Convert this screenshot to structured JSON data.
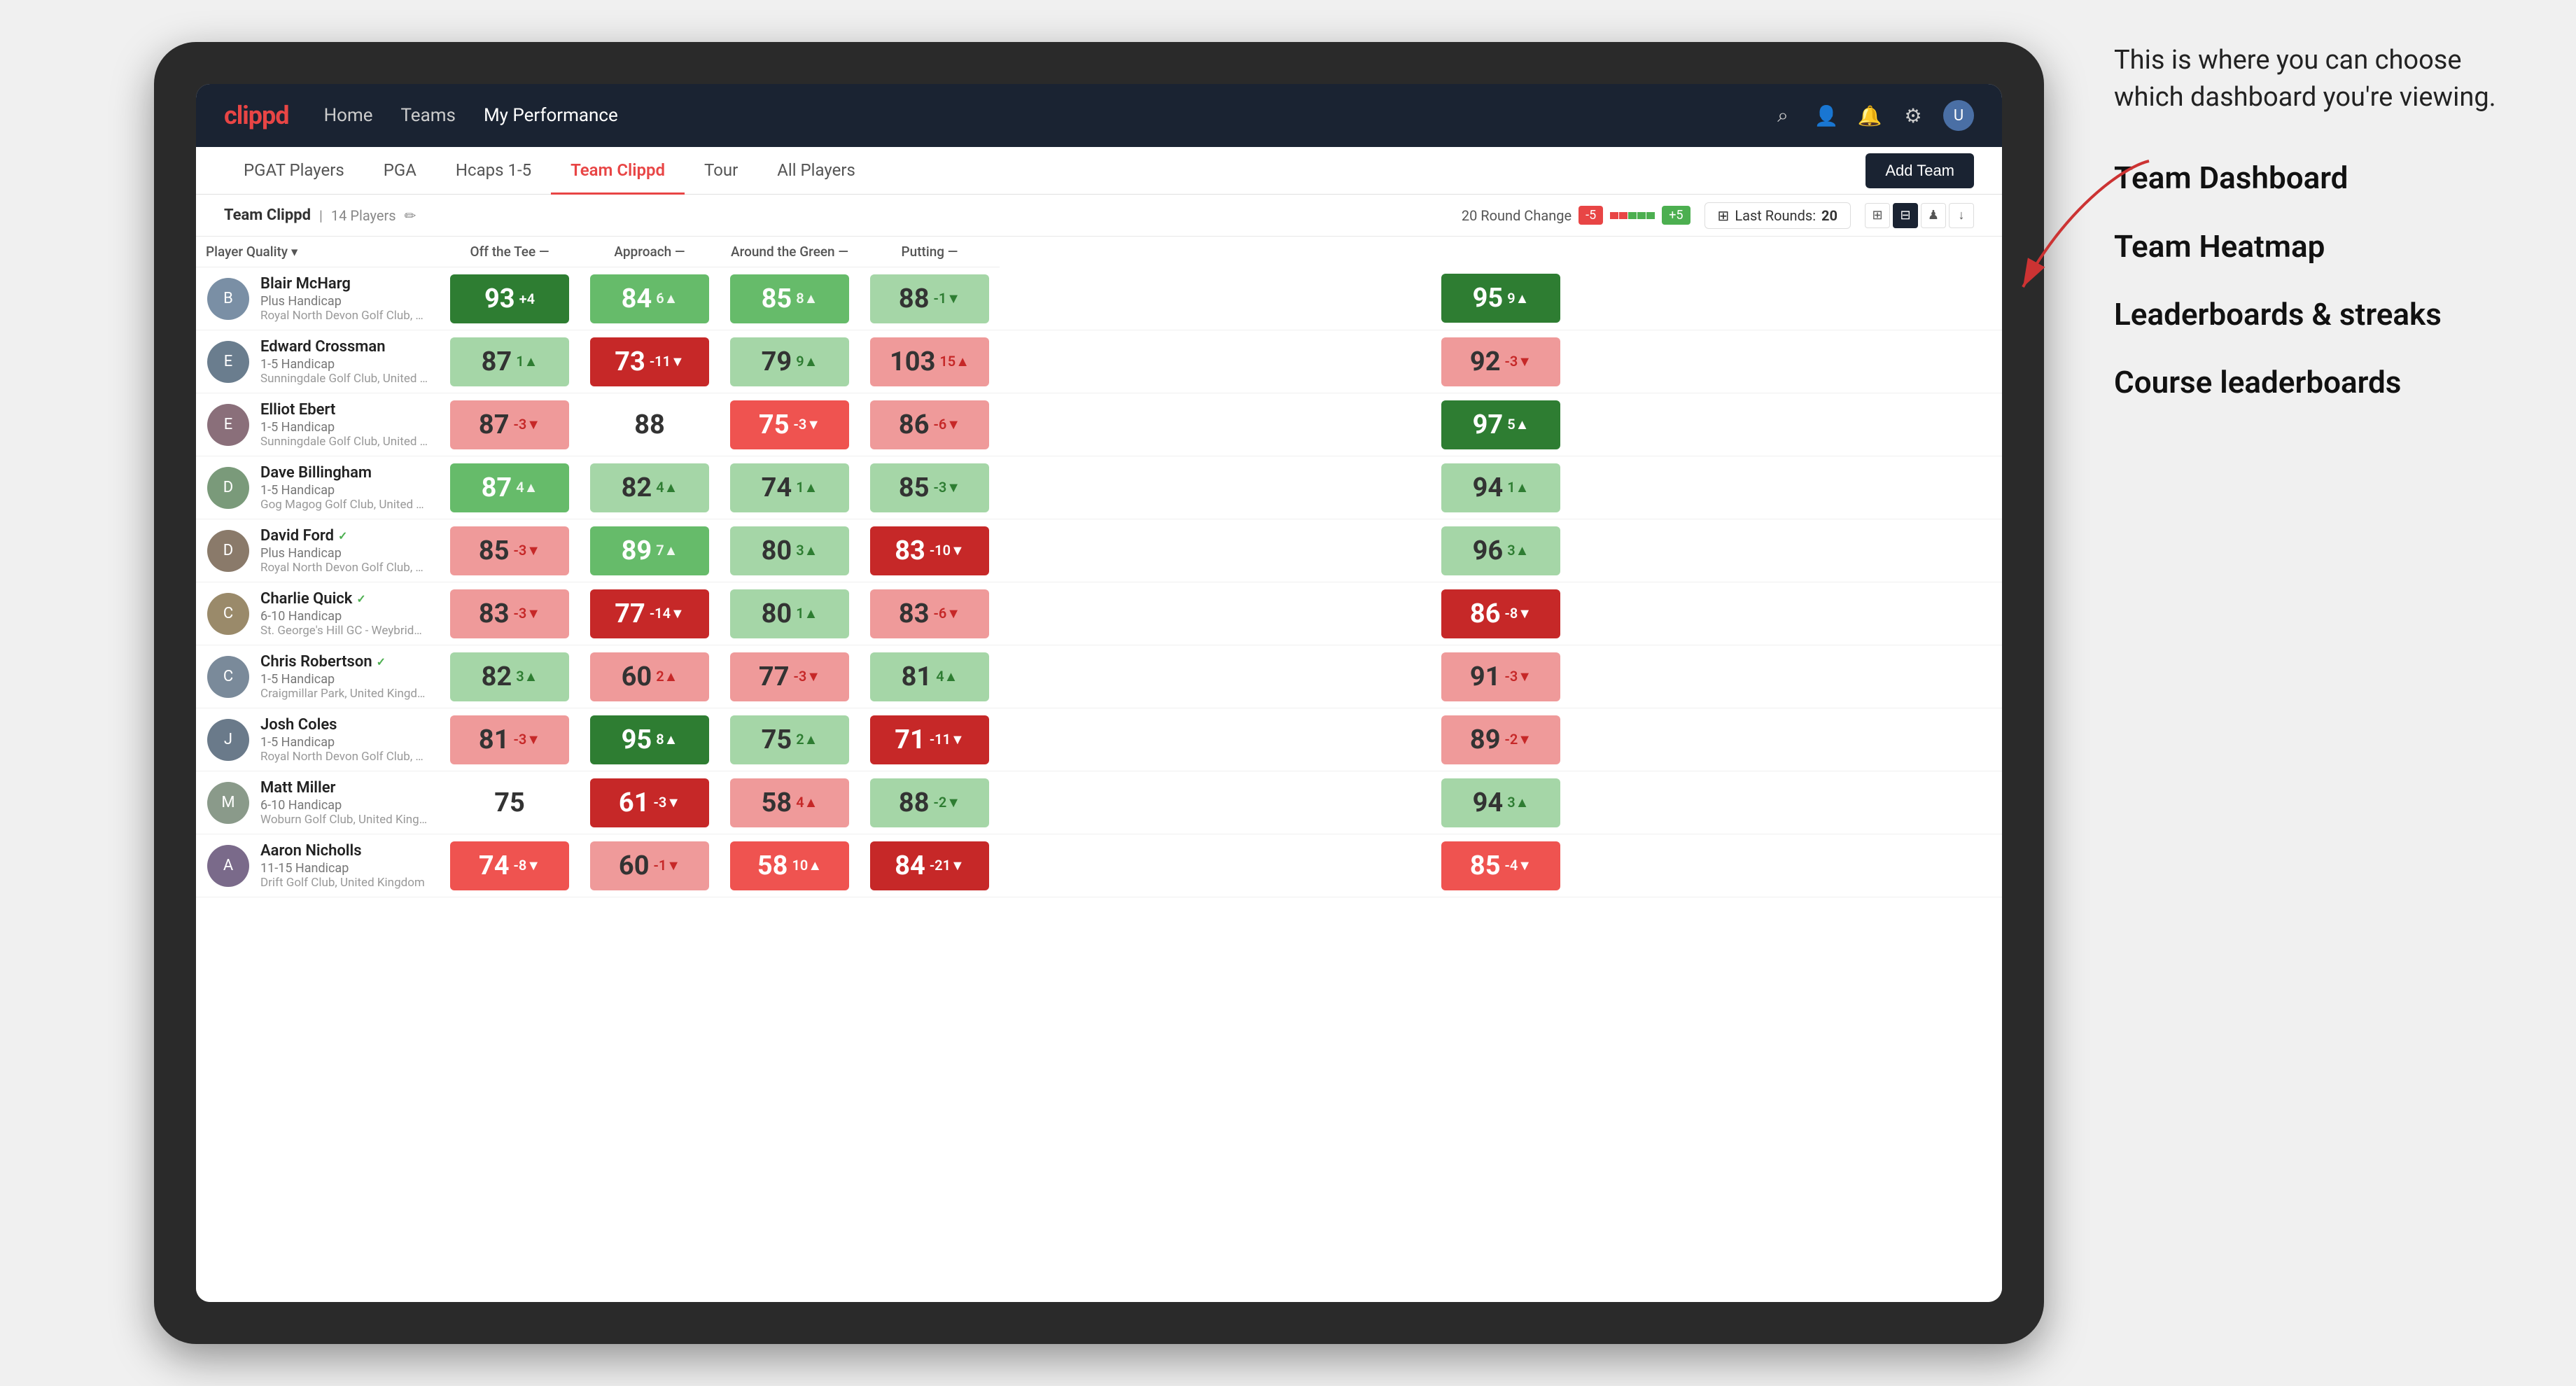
{
  "annotation": {
    "intro": "This is where you can choose which dashboard you're viewing.",
    "items": [
      "Team Dashboard",
      "Team Heatmap",
      "Leaderboards & streaks",
      "Course leaderboards"
    ]
  },
  "navbar": {
    "logo": "clippd",
    "nav_items": [
      "Home",
      "Teams",
      "My Performance"
    ],
    "active_nav": "My Performance"
  },
  "subnav": {
    "tabs": [
      "PGAT Players",
      "PGA",
      "Hcaps 1-5",
      "Team Clippd",
      "Tour",
      "All Players"
    ],
    "active_tab": "Team Clippd",
    "add_team_label": "Add Team"
  },
  "team_header": {
    "name": "Team Clippd",
    "separator": "|",
    "player_count": "14 Players",
    "round_change_label": "20 Round Change",
    "change_neg": "-5",
    "change_pos": "+5",
    "last_rounds_label": "Last Rounds:",
    "last_rounds_value": "20"
  },
  "columns": {
    "player": "Player Quality",
    "off_tee": "Off the Tee",
    "approach": "Approach",
    "around_green": "Around the Green",
    "putting": "Putting"
  },
  "players": [
    {
      "name": "Blair McHarg",
      "handicap": "Plus Handicap",
      "club": "Royal North Devon Golf Club, United Kingdom",
      "avatar_color": "#7a8fa5",
      "scores": {
        "quality": {
          "value": 93,
          "delta": "+4",
          "dir": "up",
          "heat": "heat-green-strong"
        },
        "off_tee": {
          "value": 84,
          "delta": "6▲",
          "dir": "up",
          "heat": "heat-green-med"
        },
        "approach": {
          "value": 85,
          "delta": "8▲",
          "dir": "up",
          "heat": "heat-green-med"
        },
        "around_green": {
          "value": 88,
          "delta": "-1▼",
          "dir": "down",
          "heat": "heat-green-light"
        },
        "putting": {
          "value": 95,
          "delta": "9▲",
          "dir": "up",
          "heat": "heat-green-strong"
        }
      }
    },
    {
      "name": "Edward Crossman",
      "handicap": "1-5 Handicap",
      "club": "Sunningdale Golf Club, United Kingdom",
      "avatar_color": "#6a7d8e",
      "scores": {
        "quality": {
          "value": 87,
          "delta": "1▲",
          "dir": "up",
          "heat": "heat-green-light"
        },
        "off_tee": {
          "value": 73,
          "delta": "-11▼",
          "dir": "down",
          "heat": "heat-red-strong"
        },
        "approach": {
          "value": 79,
          "delta": "9▲",
          "dir": "up",
          "heat": "heat-green-light"
        },
        "around_green": {
          "value": 103,
          "delta": "15▲",
          "dir": "up",
          "heat": "heat-red-light"
        },
        "putting": {
          "value": 92,
          "delta": "-3▼",
          "dir": "down",
          "heat": "heat-red-light"
        }
      }
    },
    {
      "name": "Elliot Ebert",
      "handicap": "1-5 Handicap",
      "club": "Sunningdale Golf Club, United Kingdom",
      "avatar_color": "#8a6f7a",
      "scores": {
        "quality": {
          "value": 87,
          "delta": "-3▼",
          "dir": "down",
          "heat": "heat-red-light"
        },
        "off_tee": {
          "value": 88,
          "delta": "",
          "dir": "neutral",
          "heat": "heat-neutral"
        },
        "approach": {
          "value": 75,
          "delta": "-3▼",
          "dir": "down",
          "heat": "heat-red-med"
        },
        "around_green": {
          "value": 86,
          "delta": "-6▼",
          "dir": "down",
          "heat": "heat-red-light"
        },
        "putting": {
          "value": 97,
          "delta": "5▲",
          "dir": "up",
          "heat": "heat-green-strong"
        }
      }
    },
    {
      "name": "Dave Billingham",
      "handicap": "1-5 Handicap",
      "club": "Gog Magog Golf Club, United Kingdom",
      "avatar_color": "#7a9a7a",
      "scores": {
        "quality": {
          "value": 87,
          "delta": "4▲",
          "dir": "up",
          "heat": "heat-green-med"
        },
        "off_tee": {
          "value": 82,
          "delta": "4▲",
          "dir": "up",
          "heat": "heat-green-light"
        },
        "approach": {
          "value": 74,
          "delta": "1▲",
          "dir": "up",
          "heat": "heat-green-light"
        },
        "around_green": {
          "value": 85,
          "delta": "-3▼",
          "dir": "down",
          "heat": "heat-green-light"
        },
        "putting": {
          "value": 94,
          "delta": "1▲",
          "dir": "up",
          "heat": "heat-green-light"
        }
      }
    },
    {
      "name": "David Ford",
      "handicap": "Plus Handicap",
      "club": "Royal North Devon Golf Club, United Kingdom",
      "avatar_color": "#8a7a6a",
      "verified": true,
      "scores": {
        "quality": {
          "value": 85,
          "delta": "-3▼",
          "dir": "down",
          "heat": "heat-red-light"
        },
        "off_tee": {
          "value": 89,
          "delta": "7▲",
          "dir": "up",
          "heat": "heat-green-med"
        },
        "approach": {
          "value": 80,
          "delta": "3▲",
          "dir": "up",
          "heat": "heat-green-light"
        },
        "around_green": {
          "value": 83,
          "delta": "-10▼",
          "dir": "down",
          "heat": "heat-red-strong"
        },
        "putting": {
          "value": 96,
          "delta": "3▲",
          "dir": "up",
          "heat": "heat-green-light"
        }
      }
    },
    {
      "name": "Charlie Quick",
      "handicap": "6-10 Handicap",
      "club": "St. George's Hill GC - Weybridge - Surrey, Uni...",
      "avatar_color": "#9a8a6a",
      "verified": true,
      "scores": {
        "quality": {
          "value": 83,
          "delta": "-3▼",
          "dir": "down",
          "heat": "heat-red-light"
        },
        "off_tee": {
          "value": 77,
          "delta": "-14▼",
          "dir": "down",
          "heat": "heat-red-strong"
        },
        "approach": {
          "value": 80,
          "delta": "1▲",
          "dir": "up",
          "heat": "heat-green-light"
        },
        "around_green": {
          "value": 83,
          "delta": "-6▼",
          "dir": "down",
          "heat": "heat-red-light"
        },
        "putting": {
          "value": 86,
          "delta": "-8▼",
          "dir": "down",
          "heat": "heat-red-strong"
        }
      }
    },
    {
      "name": "Chris Robertson",
      "handicap": "1-5 Handicap",
      "club": "Craigmillar Park, United Kingdom",
      "avatar_color": "#7a8a9a",
      "verified": true,
      "scores": {
        "quality": {
          "value": 82,
          "delta": "3▲",
          "dir": "up",
          "heat": "heat-green-light"
        },
        "off_tee": {
          "value": 60,
          "delta": "2▲",
          "dir": "up",
          "heat": "heat-red-light"
        },
        "approach": {
          "value": 77,
          "delta": "-3▼",
          "dir": "down",
          "heat": "heat-red-light"
        },
        "around_green": {
          "value": 81,
          "delta": "4▲",
          "dir": "up",
          "heat": "heat-green-light"
        },
        "putting": {
          "value": 91,
          "delta": "-3▼",
          "dir": "down",
          "heat": "heat-red-light"
        }
      }
    },
    {
      "name": "Josh Coles",
      "handicap": "1-5 Handicap",
      "club": "Royal North Devon Golf Club, United Kingdom",
      "avatar_color": "#6a7a8a",
      "scores": {
        "quality": {
          "value": 81,
          "delta": "-3▼",
          "dir": "down",
          "heat": "heat-red-light"
        },
        "off_tee": {
          "value": 95,
          "delta": "8▲",
          "dir": "up",
          "heat": "heat-green-strong"
        },
        "approach": {
          "value": 75,
          "delta": "2▲",
          "dir": "up",
          "heat": "heat-green-light"
        },
        "around_green": {
          "value": 71,
          "delta": "-11▼",
          "dir": "down",
          "heat": "heat-red-strong"
        },
        "putting": {
          "value": 89,
          "delta": "-2▼",
          "dir": "down",
          "heat": "heat-red-light"
        }
      }
    },
    {
      "name": "Matt Miller",
      "handicap": "6-10 Handicap",
      "club": "Woburn Golf Club, United Kingdom",
      "avatar_color": "#8a9a8a",
      "scores": {
        "quality": {
          "value": 75,
          "delta": "",
          "dir": "neutral",
          "heat": "heat-neutral"
        },
        "off_tee": {
          "value": 61,
          "delta": "-3▼",
          "dir": "down",
          "heat": "heat-red-strong"
        },
        "approach": {
          "value": 58,
          "delta": "4▲",
          "dir": "up",
          "heat": "heat-red-light"
        },
        "around_green": {
          "value": 88,
          "delta": "-2▼",
          "dir": "down",
          "heat": "heat-green-light"
        },
        "putting": {
          "value": 94,
          "delta": "3▲",
          "dir": "up",
          "heat": "heat-green-light"
        }
      }
    },
    {
      "name": "Aaron Nicholls",
      "handicap": "11-15 Handicap",
      "club": "Drift Golf Club, United Kingdom",
      "avatar_color": "#7a6a8a",
      "scores": {
        "quality": {
          "value": 74,
          "delta": "-8▼",
          "dir": "down",
          "heat": "heat-red-med"
        },
        "off_tee": {
          "value": 60,
          "delta": "-1▼",
          "dir": "down",
          "heat": "heat-red-light"
        },
        "approach": {
          "value": 58,
          "delta": "10▲",
          "dir": "up",
          "heat": "heat-red-med"
        },
        "around_green": {
          "value": 84,
          "delta": "-21▼",
          "dir": "down",
          "heat": "heat-red-strong"
        },
        "putting": {
          "value": 85,
          "delta": "-4▼",
          "dir": "down",
          "heat": "heat-red-med"
        }
      }
    }
  ]
}
